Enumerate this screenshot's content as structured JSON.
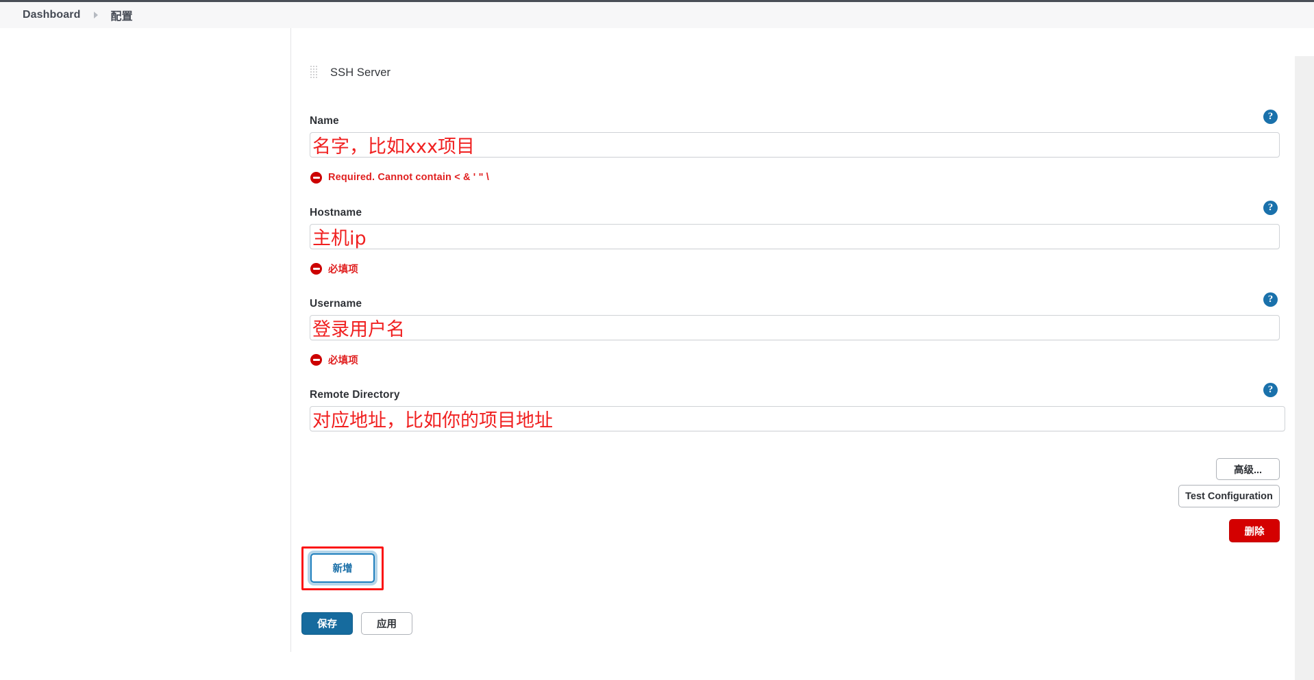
{
  "breadcrumb": {
    "root": "Dashboard",
    "separator_icon": "chevron-right-icon",
    "leaf": "配置"
  },
  "section": {
    "drag_handle_icon": "drag-handle-icon",
    "title": "SSH Server"
  },
  "fields": [
    {
      "label": "Name",
      "value": "",
      "help_icon": "help-circle-icon",
      "help_label": "?",
      "annotation": "名字，比如xxx项目",
      "error": "Required. Cannot contain < & ' \" \\",
      "error_icon": "error-circle-icon"
    },
    {
      "label": "Hostname",
      "value": "",
      "help_icon": "help-circle-icon",
      "help_label": "?",
      "annotation": "主机ip",
      "error": "必填项",
      "error_icon": "error-circle-icon"
    },
    {
      "label": "Username",
      "value": "",
      "help_icon": "help-circle-icon",
      "help_label": "?",
      "annotation": "登录用户名",
      "error": "必填项",
      "error_icon": "error-circle-icon"
    },
    {
      "label": "Remote Directory",
      "value": "",
      "help_icon": "help-circle-icon",
      "help_label": "?",
      "annotation": "对应地址，比如你的项目地址",
      "error": "",
      "error_icon": ""
    }
  ],
  "actions": {
    "advanced": "高级...",
    "test_configuration": "Test Configuration",
    "delete": "删除",
    "add_new": "新增"
  },
  "footer": {
    "save": "保存",
    "apply": "应用"
  },
  "colors": {
    "accent_blue": "#166b9e",
    "danger_red": "#d40000",
    "annotation_red": "#f02020",
    "error_red": "#e02020",
    "help_blue": "#1a71ab",
    "header_bg": "#f7f7f8"
  }
}
